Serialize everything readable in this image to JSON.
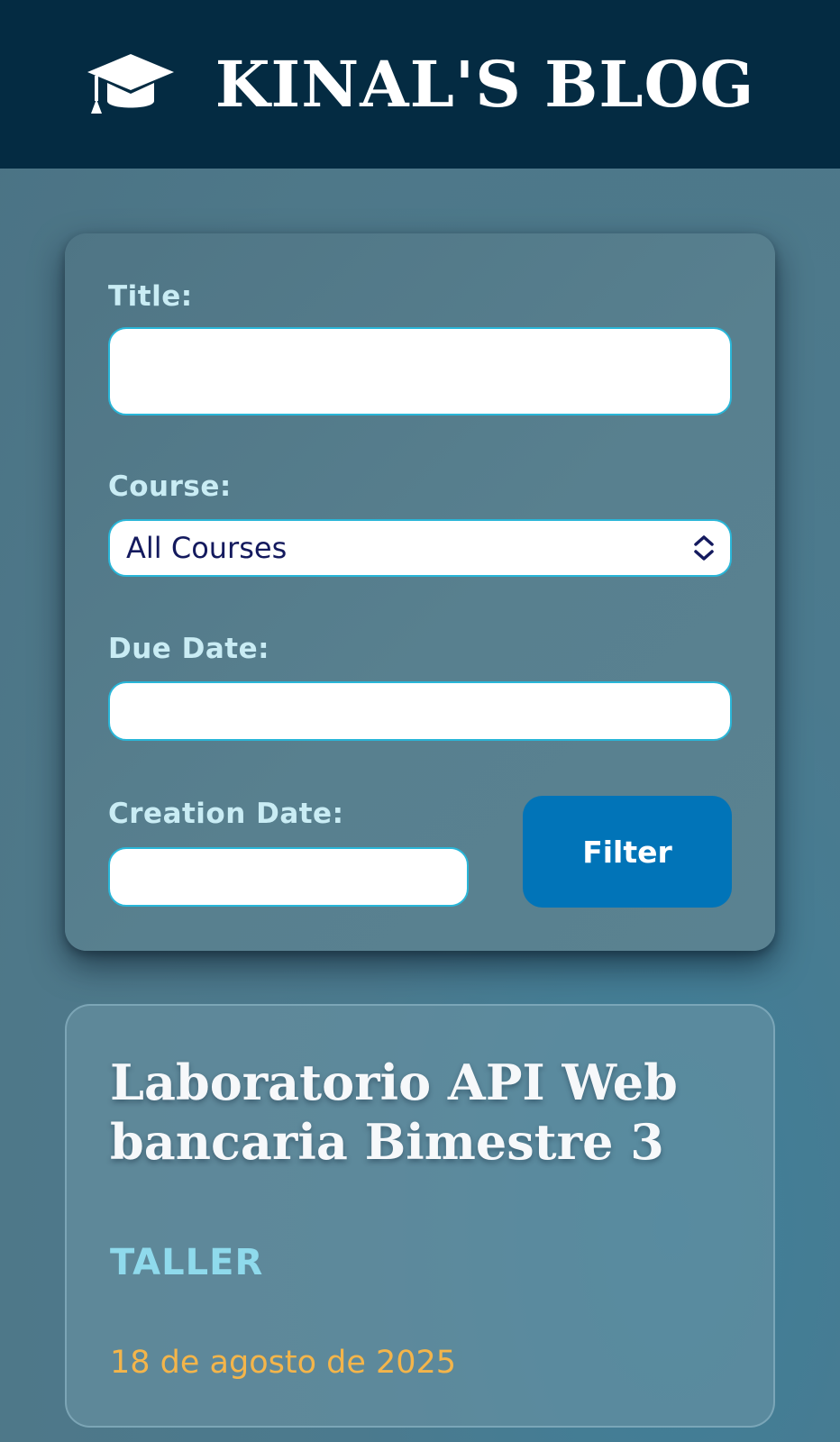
{
  "header": {
    "brand": "KINAL'S BLOG",
    "icon": "graduation-cap-icon"
  },
  "filters": {
    "title_label": "Title:",
    "title_value": "",
    "course_label": "Course:",
    "course_selected": "All Courses",
    "course_icon": "chevron-updown-icon",
    "due_date_label": "Due Date:",
    "due_date_value": "",
    "creation_date_label": "Creation Date:",
    "creation_date_value": "",
    "filter_button": "Filter"
  },
  "posts": [
    {
      "title": "Laboratorio API Web bancaria Bimestre 3",
      "course": "TALLER",
      "date": "18 de agosto de 2025"
    }
  ],
  "colors": {
    "header_bg": "#042b42",
    "accent_button": "#0174b8",
    "label_text": "#c9ecf4",
    "course_text": "#8fdaec",
    "date_text": "#f4b54a",
    "input_border": "#29b6d8"
  }
}
